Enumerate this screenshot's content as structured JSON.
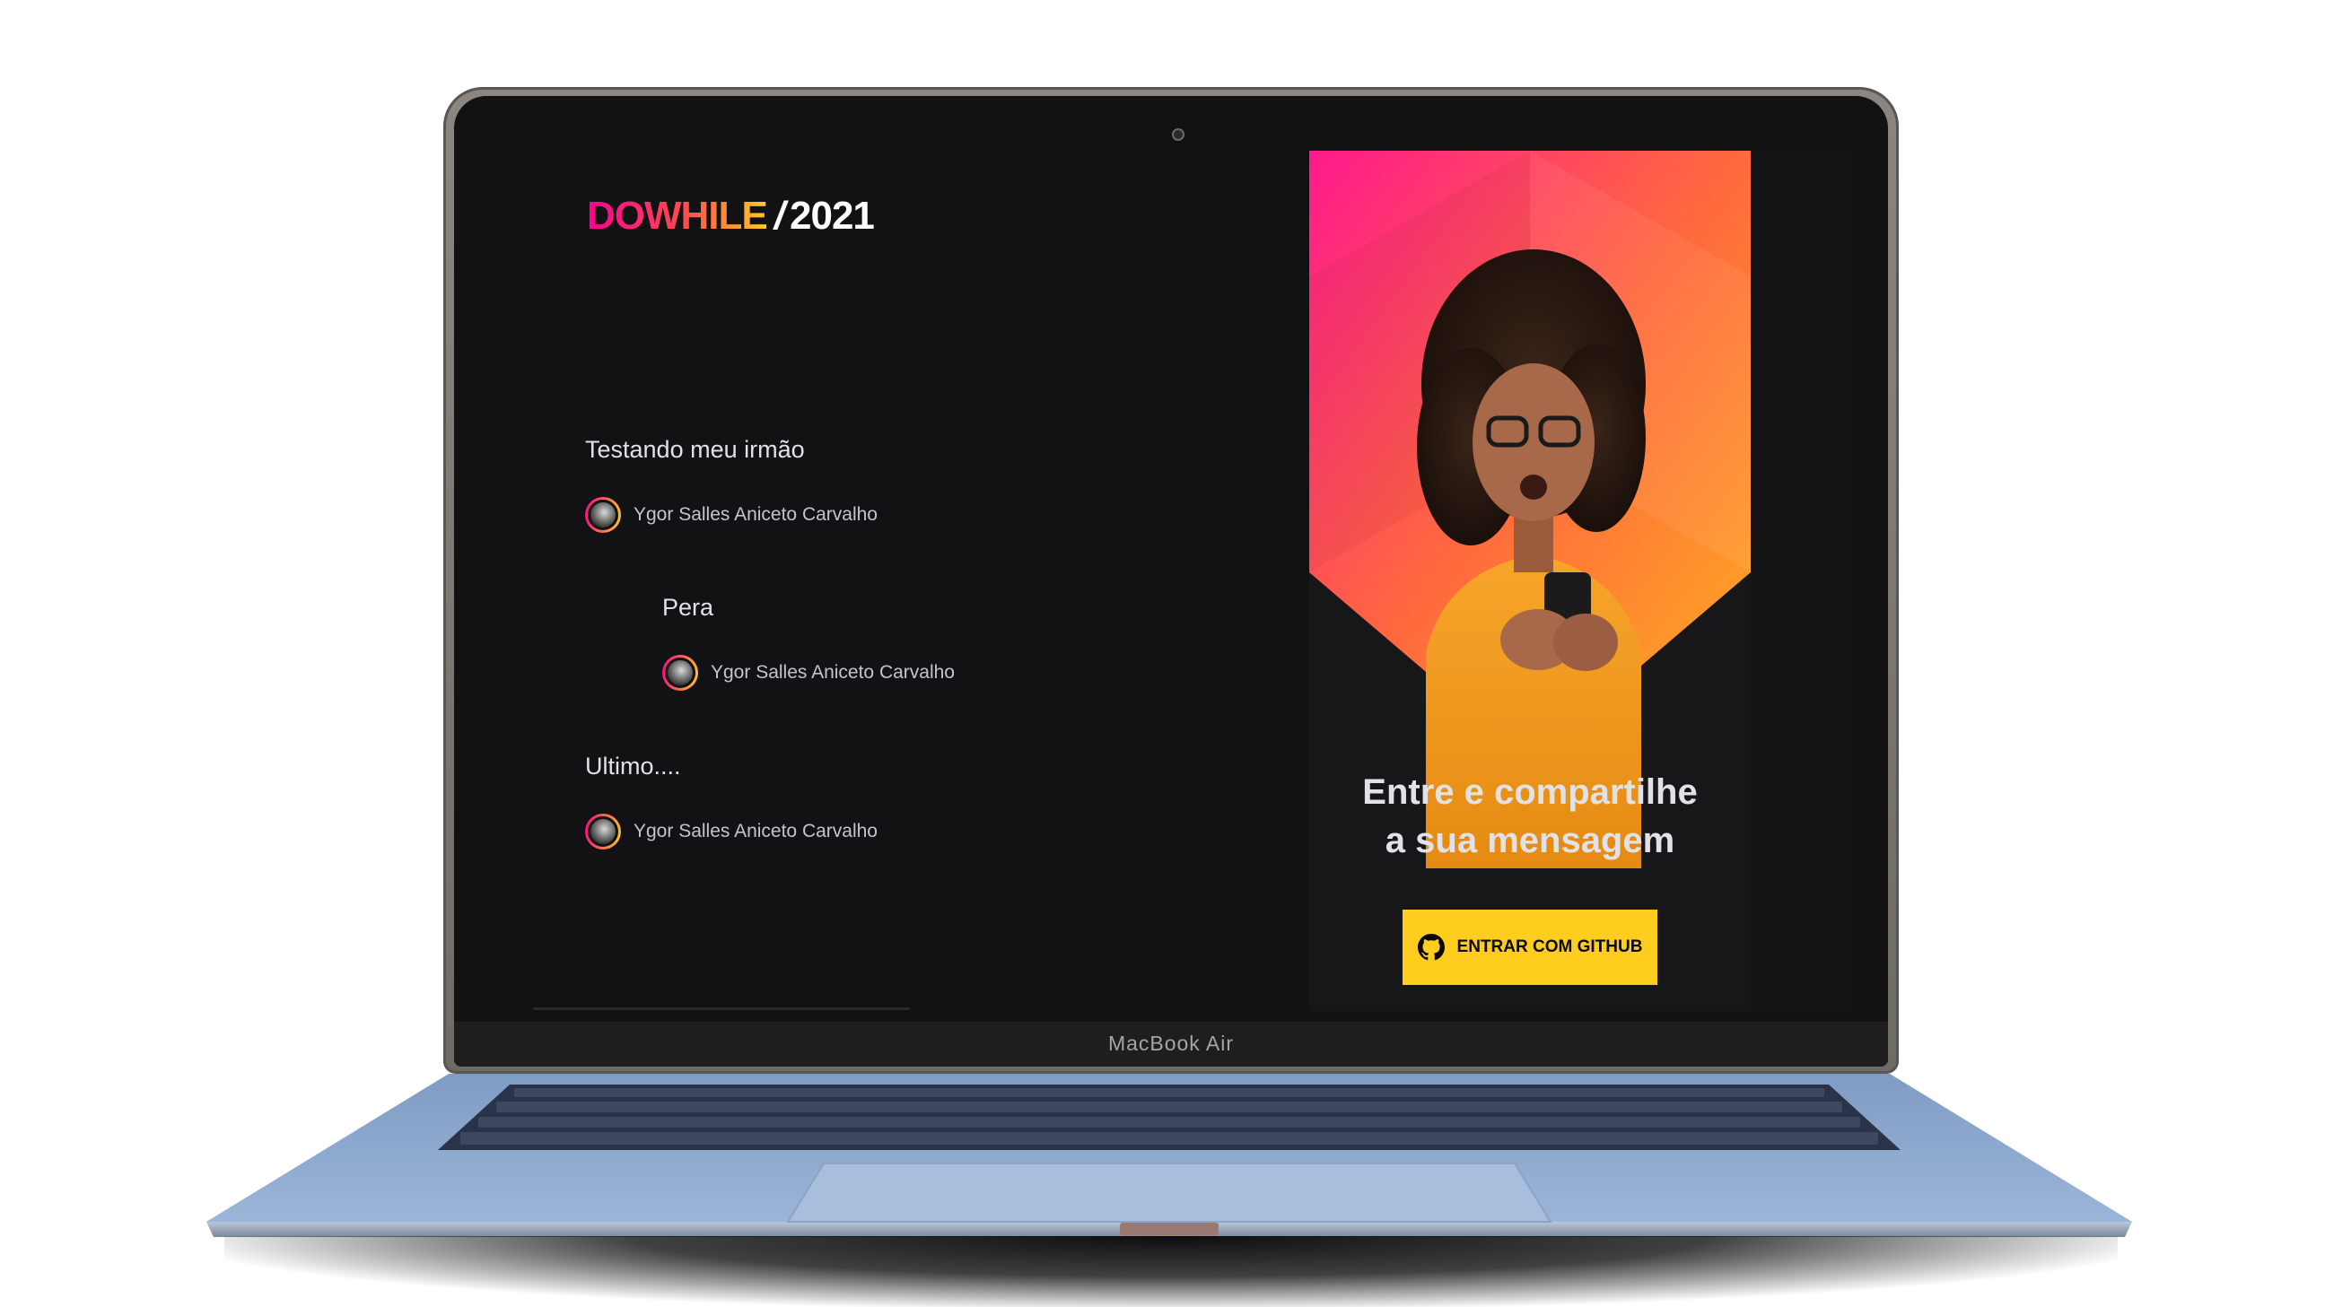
{
  "device": {
    "model_label": "MacBook Air"
  },
  "app": {
    "logo": {
      "main": "DOWHILE",
      "separator": "/",
      "year": "2021"
    },
    "messages": [
      {
        "text": "Testando meu irmão",
        "user": "Ygor Salles Aniceto Carvalho"
      },
      {
        "text": "Pera",
        "user": "Ygor Salles Aniceto Carvalho"
      },
      {
        "text": "Ultimo....",
        "user": "Ygor Salles Aniceto Carvalho"
      }
    ],
    "login": {
      "headline_line1": "Entre e compartilhe",
      "headline_line2": "a sua mensagem",
      "button_label": "ENTRAR COM GITHUB",
      "button_icon": "github-icon"
    }
  },
  "colors": {
    "background": "#121214",
    "text": "#e1e1e6",
    "accent_pink": "#ff008e",
    "accent_yellow": "#ffcd1e",
    "button": "#ffcd1e"
  }
}
